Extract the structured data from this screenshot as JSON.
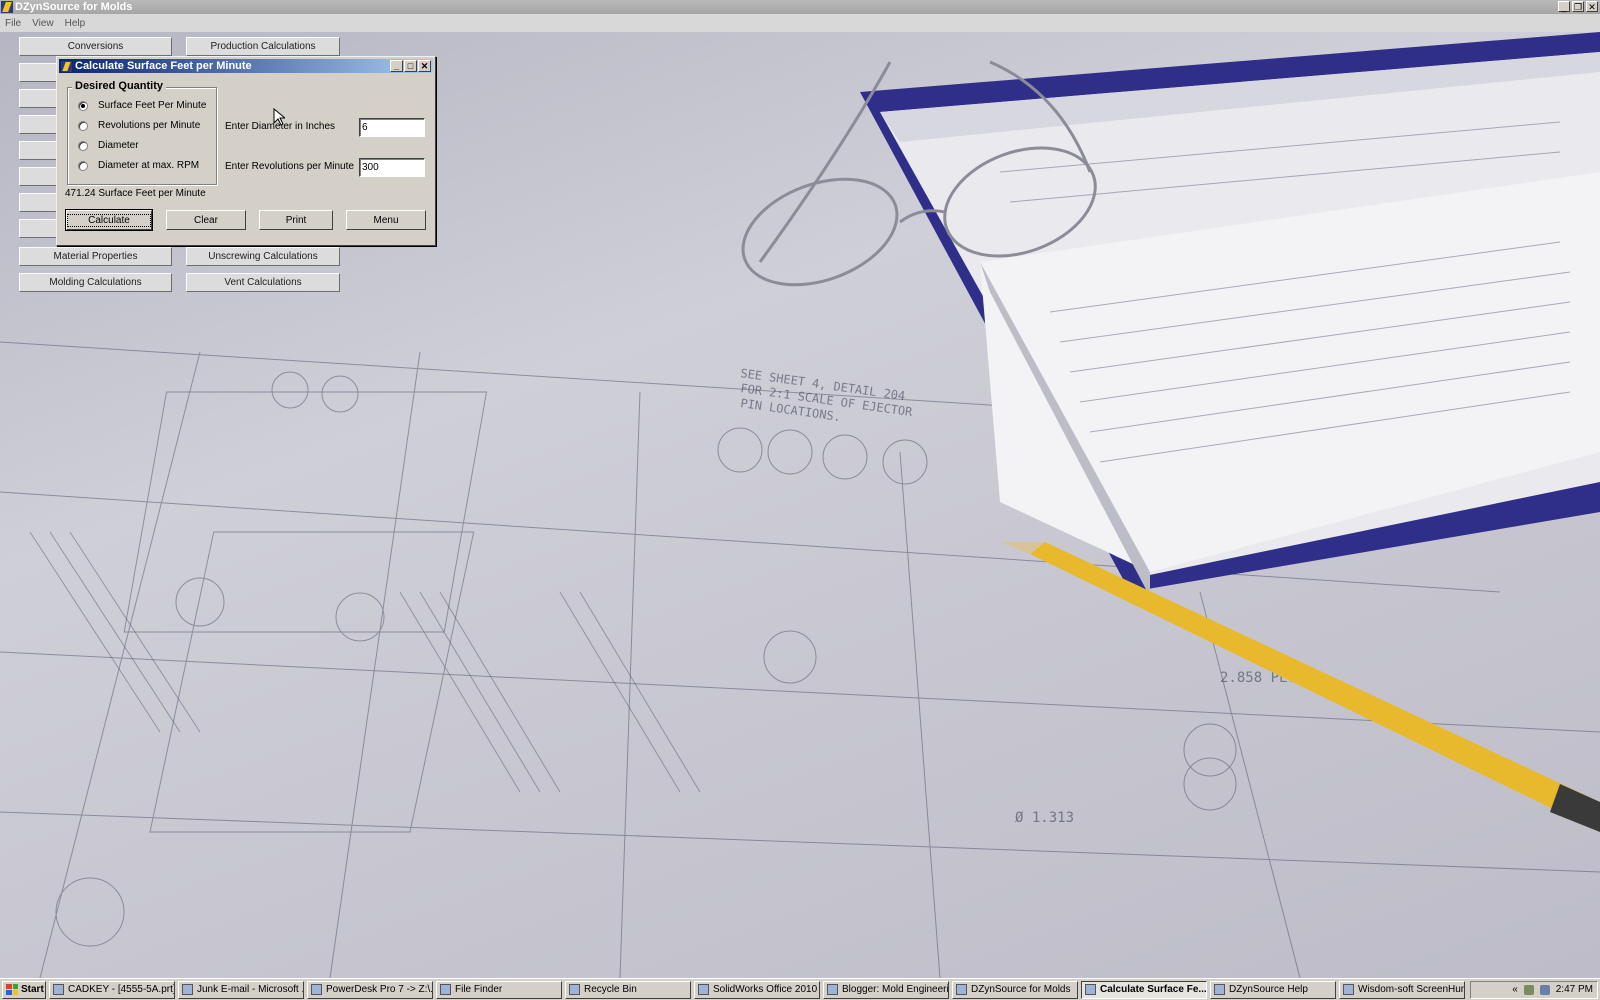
{
  "app": {
    "title": "DZynSource for Molds"
  },
  "menu": [
    "File",
    "View",
    "Help"
  ],
  "main_buttons": {
    "conversions": "Conversions",
    "production": "Production Calculations",
    "material": "Material Properties",
    "unscrewing": "Unscrewing Calculations",
    "molding": "Molding Calculations",
    "vent": "Vent Calculations"
  },
  "dialog": {
    "title": "Calculate Surface Feet per Minute",
    "group_label": "Desired Quantity",
    "options": [
      "Surface Feet Per Minute",
      "Revolutions per Minute",
      "Diameter",
      "Diameter at max. RPM"
    ],
    "selected_option": "Surface Feet Per Minute",
    "diameter_label": "Enter Diameter in Inches",
    "diameter_value": "6",
    "rpm_label": "Enter Revolutions per Minute",
    "rpm_value": "300",
    "result_value": "471.24",
    "result_unit": "Surface Feet per Minute",
    "buttons": {
      "calculate": "Calculate",
      "clear": "Clear",
      "print": "Print",
      "menu": "Menu"
    }
  },
  "taskbar": {
    "start": "Start",
    "tasks": [
      {
        "label": "CADKEY - [4555-5A.prt]",
        "active": false
      },
      {
        "label": "Junk E-mail - Microsoft ...",
        "active": false
      },
      {
        "label": "PowerDesk Pro 7 -> Z:\\...",
        "active": false
      },
      {
        "label": "File Finder",
        "active": false
      },
      {
        "label": "Recycle Bin",
        "active": false
      },
      {
        "label": "SolidWorks Office 2010",
        "active": false
      },
      {
        "label": "Blogger: Mold Engineeri...",
        "active": false
      },
      {
        "label": "DZynSource for Molds",
        "active": false
      },
      {
        "label": "Calculate Surface Fe...",
        "active": true
      },
      {
        "label": "DZynSource Help",
        "active": false
      },
      {
        "label": "Wisdom-soft ScreenHun...",
        "active": false
      }
    ],
    "tray_arrow": "«",
    "clock": "2:47 PM"
  },
  "colors": {
    "dialog_title_start": "#0a246a",
    "dialog_title_end": "#a6caf0",
    "button_face": "#d4d0c8"
  }
}
